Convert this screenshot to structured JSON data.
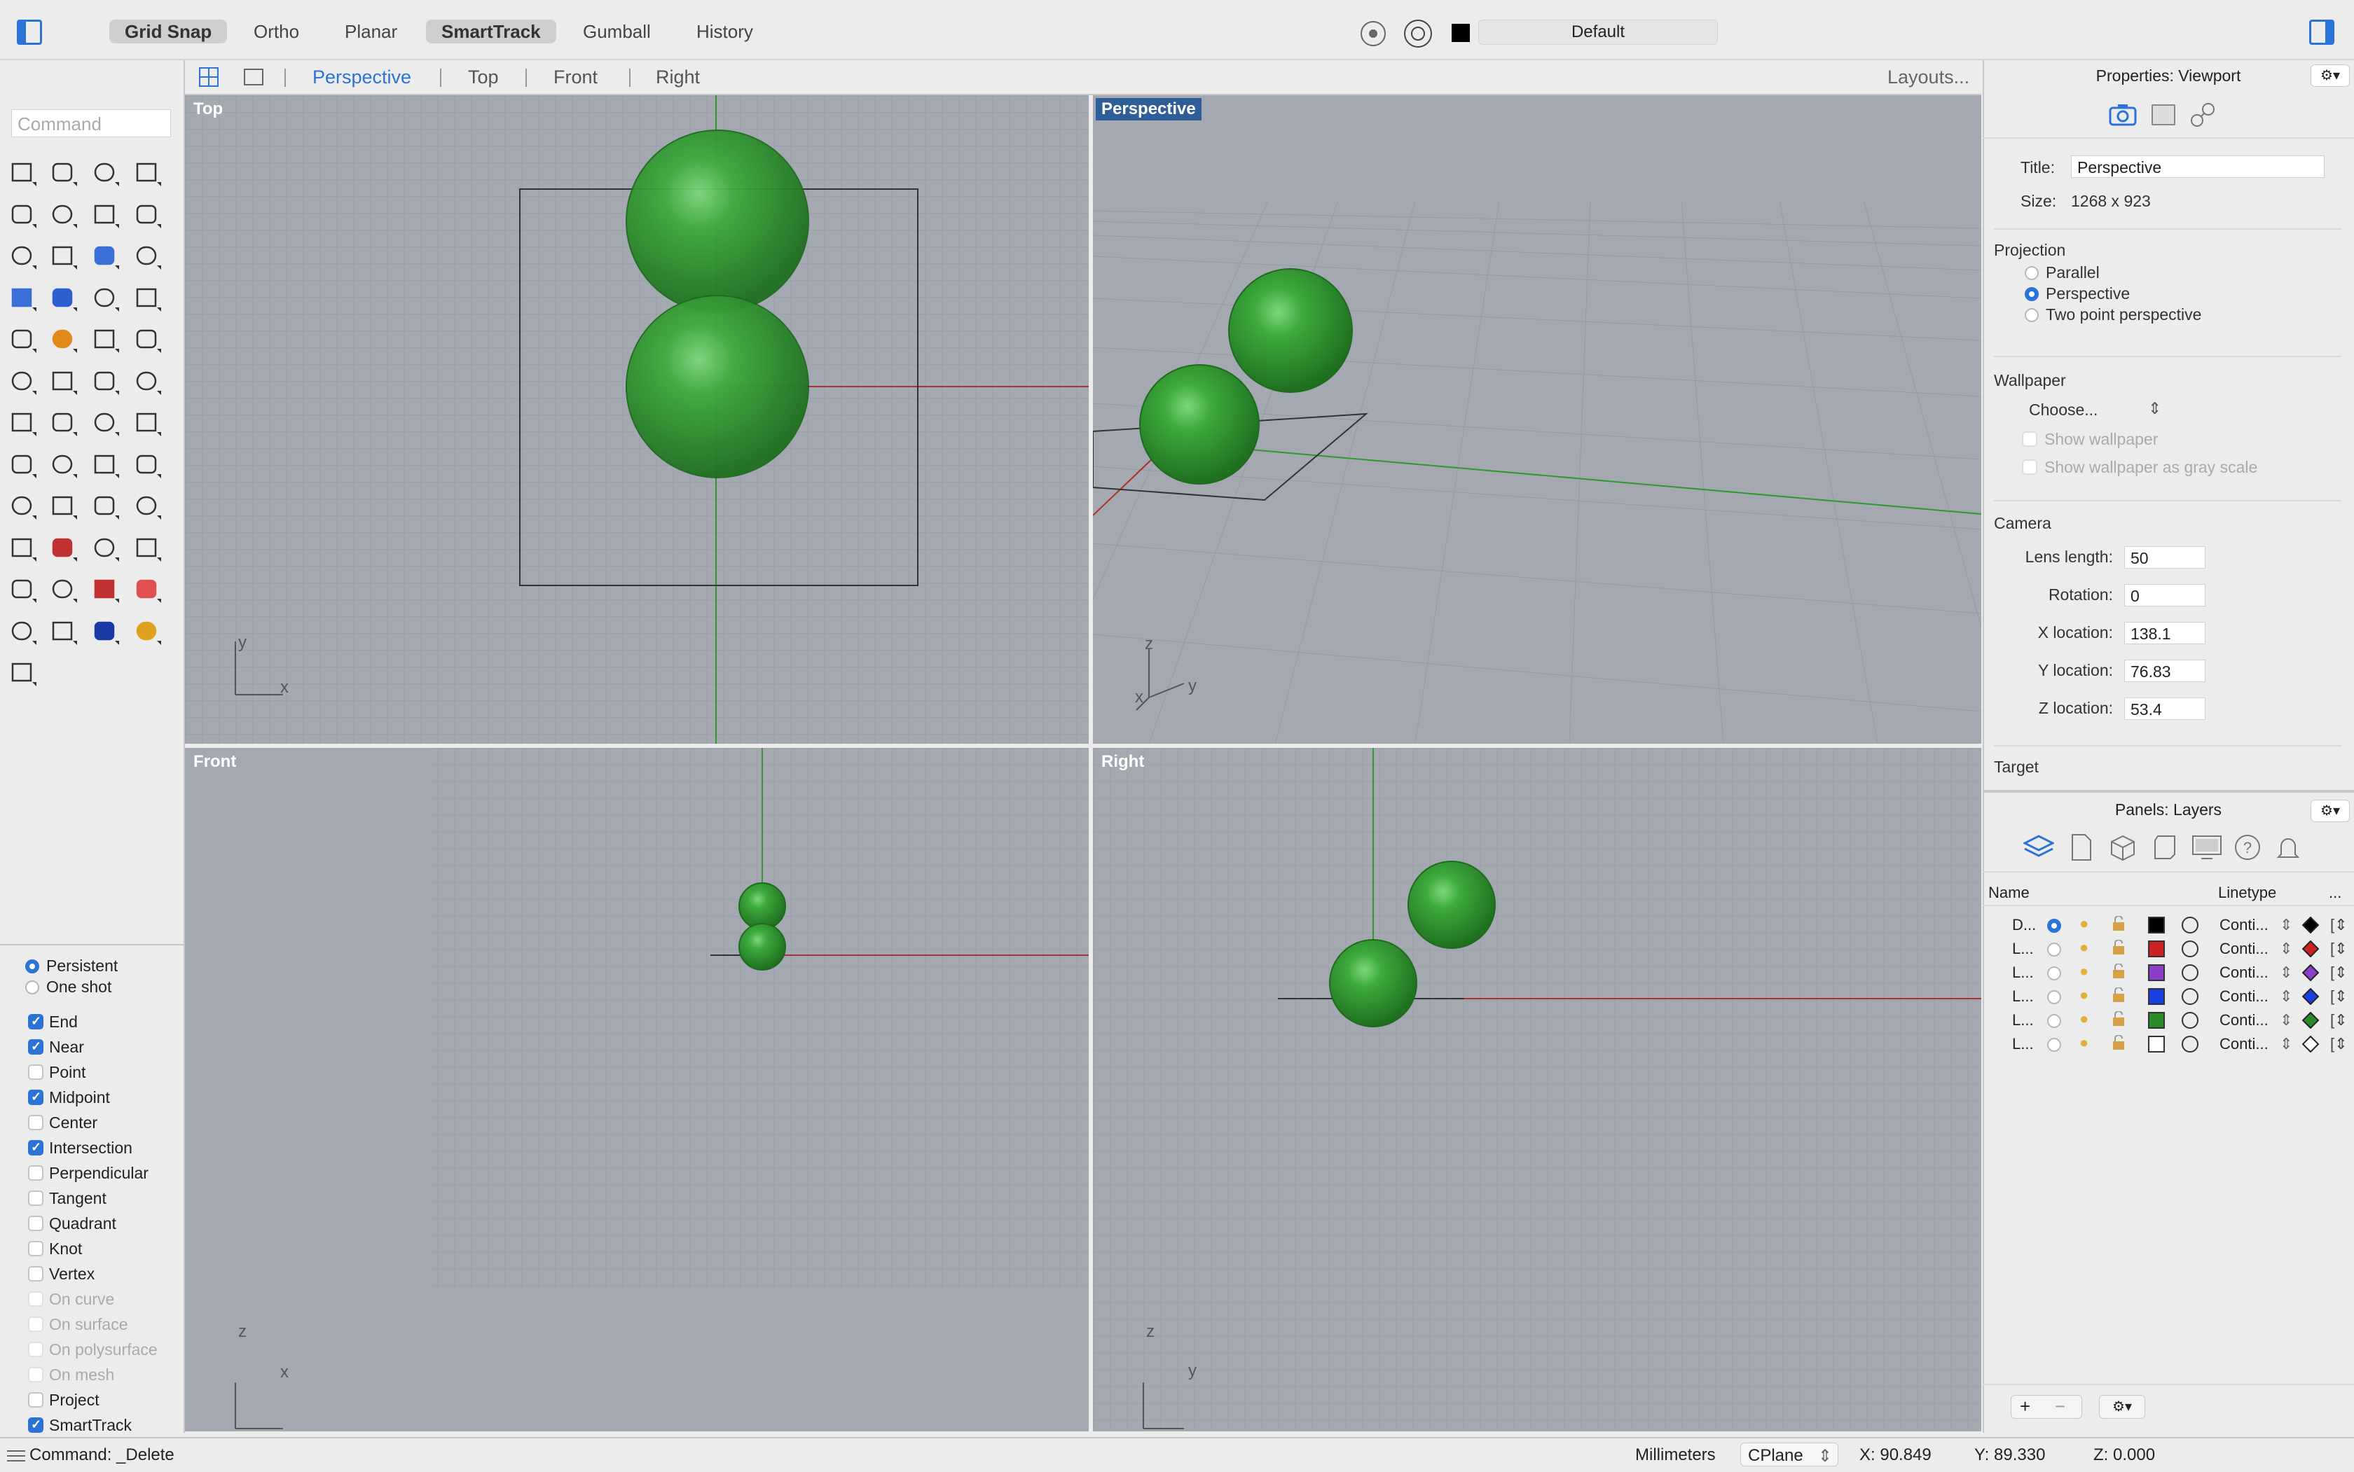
{
  "toolbar": {
    "modes": [
      {
        "label": "Grid Snap",
        "on": true
      },
      {
        "label": "Ortho",
        "on": false
      },
      {
        "label": "Planar",
        "on": false
      },
      {
        "label": "SmartTrack",
        "on": true
      },
      {
        "label": "Gumball",
        "on": false
      },
      {
        "label": "History",
        "on": false
      }
    ],
    "current_layer": "Default"
  },
  "command": {
    "placeholder": "Command",
    "last": "Command: _Delete"
  },
  "viewport_tabs": {
    "tabs": [
      "Perspective",
      "Top",
      "Front",
      "Right"
    ],
    "active": "Perspective",
    "layouts_label": "Layouts..."
  },
  "viewports": {
    "top": {
      "label": "Top",
      "axis1": "y",
      "axis2": "x"
    },
    "perspective": {
      "label": "Perspective",
      "axis1": "z",
      "axis2": "y",
      "axis3": "x"
    },
    "front": {
      "label": "Front",
      "axis1": "z",
      "axis2": "x"
    },
    "right": {
      "label": "Right",
      "axis1": "z",
      "axis2": "y"
    }
  },
  "properties": {
    "header": "Properties: Viewport",
    "title_label": "Title:",
    "title_value": "Perspective",
    "size_label": "Size:",
    "size_value": "1268 x 923",
    "projection_heading": "Projection",
    "projection_options": [
      "Parallel",
      "Perspective",
      "Two point perspective"
    ],
    "projection_selected": "Perspective",
    "wallpaper_heading": "Wallpaper",
    "wallpaper_choose": "Choose...",
    "wallpaper_show": "Show wallpaper",
    "wallpaper_gray": "Show wallpaper as gray scale",
    "camera_heading": "Camera",
    "camera": [
      {
        "label": "Lens length:",
        "value": "50"
      },
      {
        "label": "Rotation:",
        "value": "0"
      },
      {
        "label": "X location:",
        "value": "138.1"
      },
      {
        "label": "Y location:",
        "value": "76.83"
      },
      {
        "label": "Z location:",
        "value": "53.4"
      }
    ],
    "target_heading": "Target"
  },
  "layers": {
    "header": "Panels: Layers",
    "col_name": "Name",
    "col_linetype": "Linetype",
    "col_more": "...",
    "rows": [
      {
        "name": "D...",
        "current": true,
        "color": "#000000",
        "linetype": "Conti...",
        "print_color": "#000000"
      },
      {
        "name": "L...",
        "current": false,
        "color": "#cc2222",
        "linetype": "Conti...",
        "print_color": "#cc2222"
      },
      {
        "name": "L...",
        "current": false,
        "color": "#8a3fc8",
        "linetype": "Conti...",
        "print_color": "#8a3fc8"
      },
      {
        "name": "L...",
        "current": false,
        "color": "#1a3fe0",
        "linetype": "Conti...",
        "print_color": "#1a3fe0"
      },
      {
        "name": "L...",
        "current": false,
        "color": "#2a8a2a",
        "linetype": "Conti...",
        "print_color": "#2a8a2a"
      },
      {
        "name": "L...",
        "current": false,
        "color": "#ffffff",
        "linetype": "Conti...",
        "print_color": "#ffffff"
      }
    ]
  },
  "osnap": {
    "mode_options": [
      "Persistent",
      "One shot"
    ],
    "mode_selected": "Persistent",
    "items": [
      {
        "label": "End",
        "checked": true,
        "enabled": true
      },
      {
        "label": "Near",
        "checked": true,
        "enabled": true
      },
      {
        "label": "Point",
        "checked": false,
        "enabled": true
      },
      {
        "label": "Midpoint",
        "checked": true,
        "enabled": true
      },
      {
        "label": "Center",
        "checked": false,
        "enabled": true
      },
      {
        "label": "Intersection",
        "checked": true,
        "enabled": true
      },
      {
        "label": "Perpendicular",
        "checked": false,
        "enabled": true
      },
      {
        "label": "Tangent",
        "checked": false,
        "enabled": true
      },
      {
        "label": "Quadrant",
        "checked": false,
        "enabled": true
      },
      {
        "label": "Knot",
        "checked": false,
        "enabled": true
      },
      {
        "label": "Vertex",
        "checked": false,
        "enabled": true
      },
      {
        "label": "On curve",
        "checked": false,
        "enabled": false
      },
      {
        "label": "On surface",
        "checked": false,
        "enabled": false
      },
      {
        "label": "On polysurface",
        "checked": false,
        "enabled": false
      },
      {
        "label": "On mesh",
        "checked": false,
        "enabled": false
      },
      {
        "label": "Project",
        "checked": false,
        "enabled": true
      },
      {
        "label": "SmartTrack",
        "checked": true,
        "enabled": true
      }
    ]
  },
  "status": {
    "units": "Millimeters",
    "cplane": "CPlane",
    "x": "X: 90.849",
    "y": "Y: 89.330",
    "z": "Z: 0.000"
  },
  "colors": {
    "accent": "#2b73d6",
    "viewport_bg": "#a4a9b1",
    "sphere": "#2f9a2f"
  }
}
